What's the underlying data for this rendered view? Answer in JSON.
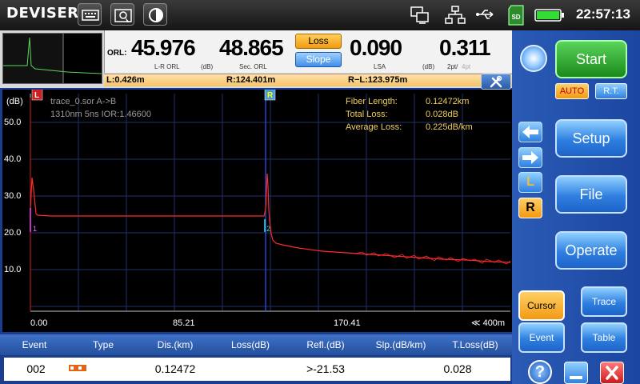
{
  "app": {
    "logo_text": "DEVISER",
    "clock": "22:57:13"
  },
  "topbar": {
    "icons": [
      "keyboard-icon",
      "screenshot-icon",
      "contrast-icon",
      "remote-desktop-icon",
      "network-icon",
      "usb-icon",
      "sd-card-icon",
      "battery-icon"
    ],
    "sd_label": "SD"
  },
  "metrics": {
    "orl_label": "ORL:",
    "lr_orl_value": "45.976",
    "lr_orl_label": "L-R ORL",
    "lr_orl_unit": "(dB)",
    "sec_orl_value": "48.865",
    "sec_orl_label": "Sec. ORL",
    "loss_button": "Loss",
    "slope_button": "Slope",
    "lsa_value": "0.090",
    "lsa_label": "LSA",
    "lsa_unit": "(dB)",
    "pt_value": "0.311",
    "pt2_label": "2pt/",
    "pt4_label": "4pt"
  },
  "cursorbar": {
    "left": "L:0.426m",
    "right": "R:124.401m",
    "diff": "R−L:123.975m"
  },
  "graph": {
    "y_unit": "(dB)",
    "y_ticks": [
      "50.0",
      "40.0",
      "30.0",
      "20.0",
      "10.0"
    ],
    "x_ticks": [
      "0.00",
      "85.21",
      "170.41",
      "≪ 400m"
    ],
    "trace_name": "trace_0.sor A->B",
    "trace_params": "1310nm  5ns  IOR:1.46600",
    "fiber_length_label": "Fiber Length:",
    "fiber_length_value": "0.12472km",
    "total_loss_label": "Total Loss:",
    "total_loss_value": "0.028dB",
    "avg_loss_label": "Average Loss:",
    "avg_loss_value": "0.225dB/km",
    "cursor_l": "L",
    "cursor_r": "R",
    "event_1": "1",
    "event_2": "2",
    "colors": {
      "trace": "#ff2a2a",
      "grid": "#1f2f66",
      "cursor_r": "#3355ff"
    }
  },
  "table": {
    "headers": [
      "Event",
      "Type",
      "Dis.(km)",
      "Loss(dB)",
      "Refl.(dB)",
      "Slp.(dB/km)",
      "T.Loss(dB)"
    ],
    "row": {
      "event": "002",
      "dis": "0.12472",
      "loss": "",
      "refl": ">-21.53",
      "slp": "",
      "tloss": "0.028"
    }
  },
  "rpanel": {
    "start": "Start",
    "auto": "AUTO",
    "rt": "R.T.",
    "setup": "Setup",
    "file": "File",
    "operate": "Operate",
    "cursor": "Cursor",
    "trace": "Trace",
    "event": "Event",
    "table": "Table",
    "nav_l": "L",
    "nav_r": "R",
    "help": "?"
  }
}
